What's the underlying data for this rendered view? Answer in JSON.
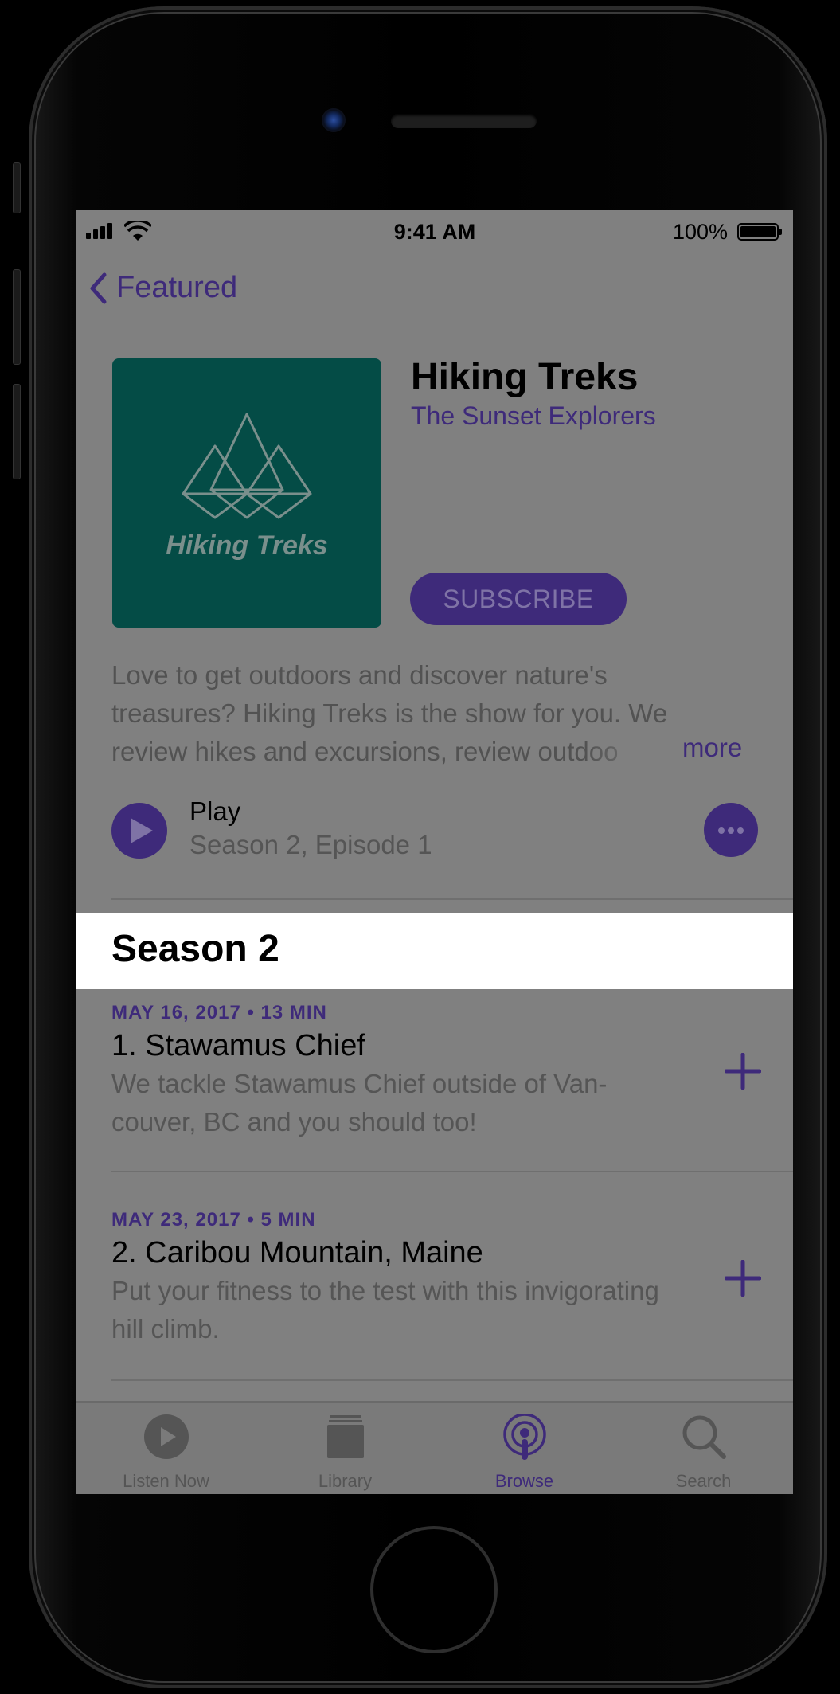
{
  "status_bar": {
    "time": "9:41 AM",
    "battery": "100%"
  },
  "nav": {
    "back_label": "Featured"
  },
  "podcast": {
    "artwork_text": "Hiking Treks",
    "title": "Hiking Treks",
    "author": "The Sunset Explorers",
    "subscribe_label": "SUBSCRIBE",
    "description_lines": [
      "Love to get outdoors and discover nature's",
      "treasures? Hiking Treks is the show for you. We",
      "review hikes and excursions, review outdoo"
    ],
    "more_label": "more"
  },
  "play": {
    "label": "Play",
    "subtitle": "Season 2, Episode 1"
  },
  "season": {
    "title": "Season 2"
  },
  "episodes": [
    {
      "meta": "MAY 16, 2017 • 13 MIN",
      "title": "1. Stawamus Chief",
      "desc_lines": [
        "We tackle Stawamus Chief outside of Van-",
        "couver, BC and you should too!"
      ]
    },
    {
      "meta": "MAY 23, 2017 • 5 MIN",
      "title": "2. Caribou Mountain, Maine",
      "desc_lines": [
        "Put your fitness to the test with this invigorating",
        "hill climb."
      ]
    }
  ],
  "tabs": [
    {
      "label": "Listen Now",
      "icon": "play-circle-icon"
    },
    {
      "label": "Library",
      "icon": "library-stack-icon"
    },
    {
      "label": "Browse",
      "icon": "podcast-broadcast-icon",
      "active": true
    },
    {
      "label": "Search",
      "icon": "magnifier-icon"
    }
  ],
  "colors": {
    "accent": "#3e2a7a",
    "artwork_bg": "#044c46",
    "screen_dim": "#808080",
    "highlight": "#ffffff"
  }
}
